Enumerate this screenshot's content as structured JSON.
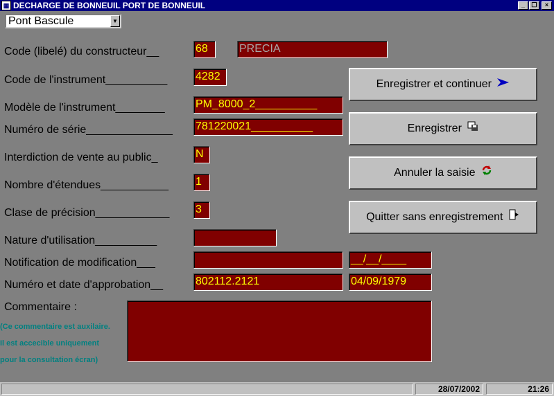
{
  "window": {
    "title": "DECHARGE DE BONNEUIL PORT DE BONNEUIL",
    "controls": {
      "minimize": "_",
      "restore": "❐",
      "close": "×"
    }
  },
  "selector": {
    "value": "Pont Bascule"
  },
  "form": {
    "constructor_label": "Code (libelé)  du constructeur__",
    "constructor_code": "68",
    "constructor_name": "PRECIA",
    "instrument_code_label": "Code de l'instrument__________",
    "instrument_code": "4282",
    "model_label": "Modèle de l'instrument________",
    "model": "PM_8000_2__________",
    "serial_label": "Numéro de série______________",
    "serial": "781220021__________",
    "public_sale_label": "Interdiction de vente au public_",
    "public_sale": "N",
    "ranges_label": "Nombre d'étendues___________",
    "ranges": "1",
    "precision_label": "Clase de précision____________",
    "precision": "3",
    "usage_label": "Nature d'utilisation__________",
    "usage": "",
    "notification_label": "Notification  de modification___",
    "notification": "",
    "notification_date": "__/__/____",
    "approval_label": "Numéro et date d'approbation__",
    "approval_number": "802112.2121",
    "approval_date": "04/09/1979",
    "comment_label": "Commentaire :",
    "comment_note_1": "(Ce commentaire est auxilaire.",
    "comment_note_2": "Il est accecible uniquement",
    "comment_note_3": "pour la consultation écran)",
    "comment": ""
  },
  "buttons": {
    "save_continue": "Enregistrer et continuer",
    "save": "Enregistrer",
    "cancel": "Annuler la saisie",
    "quit": "Quitter sans enregistrement"
  },
  "status": {
    "date": "28/07/2002",
    "time": "21:26"
  }
}
